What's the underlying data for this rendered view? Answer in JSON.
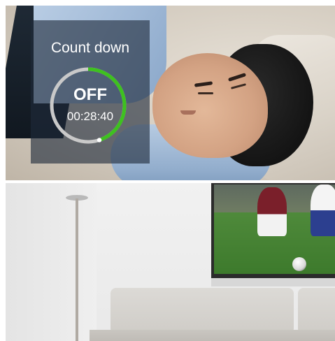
{
  "countdown": {
    "title": "Count down",
    "state": "OFF",
    "time": "00:28:40",
    "progress_fraction": 0.45,
    "ring_track_color": "#c9c9c9",
    "ring_progress_color": "#3ec11f"
  },
  "images": {
    "top": "sleeping-man-on-sofa-photo",
    "bottom": "living-room-tv-soccer-photo"
  }
}
